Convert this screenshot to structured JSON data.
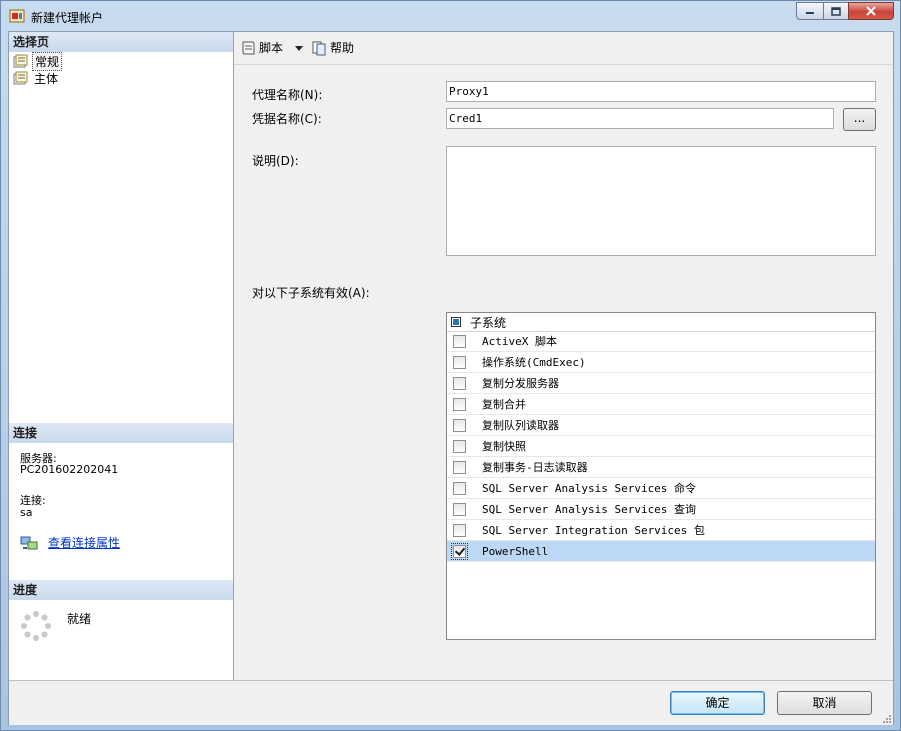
{
  "window": {
    "title": "新建代理帐户"
  },
  "left_panel": {
    "select_page_header": "选择页",
    "pages": [
      {
        "label": "常规",
        "selected": true
      },
      {
        "label": "主体",
        "selected": false
      }
    ],
    "connection_header": "连接",
    "server_label": "服务器:",
    "server_value": "PC201602202041",
    "connection_label": "连接:",
    "connection_value": "sa",
    "view_connection_link": "查看连接属性",
    "progress_header": "进度",
    "progress_status": "就绪"
  },
  "toolbar": {
    "script_label": "脚本",
    "help_label": "帮助"
  },
  "form": {
    "proxy_name_label": "代理名称(N):",
    "proxy_name_value": "Proxy1",
    "credential_label": "凭据名称(C):",
    "credential_value": "Cred1",
    "browse_label": "...",
    "description_label": "说明(D):",
    "description_value": "",
    "subsystems_label": "对以下子系统有效(A):"
  },
  "subsystems": {
    "header": "子系统",
    "items": [
      {
        "label": "ActiveX 脚本",
        "checked": false
      },
      {
        "label": "操作系统(CmdExec)",
        "checked": false
      },
      {
        "label": "复制分发服务器",
        "checked": false
      },
      {
        "label": "复制合并",
        "checked": false
      },
      {
        "label": "复制队列读取器",
        "checked": false
      },
      {
        "label": "复制快照",
        "checked": false
      },
      {
        "label": "复制事务-日志读取器",
        "checked": false
      },
      {
        "label": "SQL Server Analysis Services 命令",
        "checked": false
      },
      {
        "label": "SQL Server Analysis Services 查询",
        "checked": false
      },
      {
        "label": "SQL Server Integration Services 包",
        "checked": false
      },
      {
        "label": "PowerShell",
        "checked": true,
        "selected": true
      }
    ]
  },
  "buttons": {
    "ok_label": "确定",
    "cancel_label": "取消"
  },
  "colors": {
    "selection": "#bcd8f5",
    "section_header": "#c8d9ec",
    "link": "#0033cc"
  }
}
